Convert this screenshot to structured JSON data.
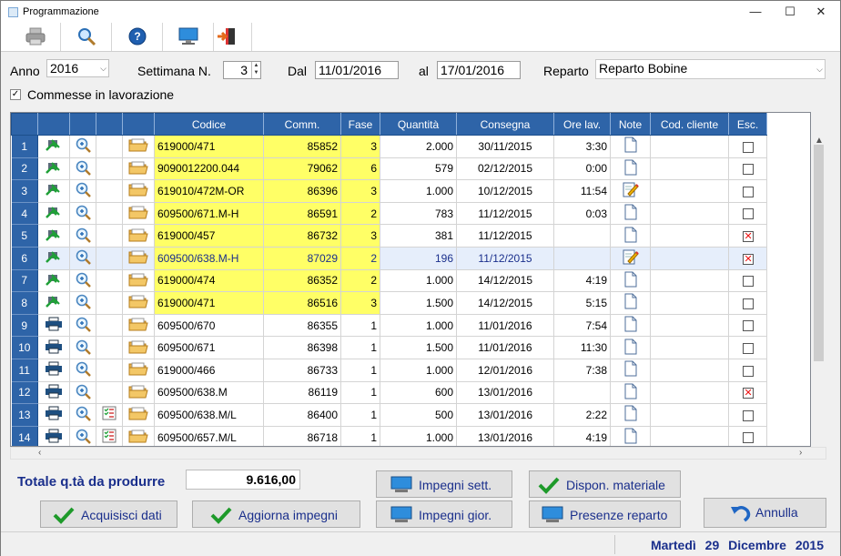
{
  "window": {
    "title": "Programmazione"
  },
  "filters": {
    "anno_label": "Anno",
    "anno_value": "2016",
    "settimana_label": "Settimana N.",
    "settimana_value": "3",
    "dal_label": "Dal",
    "dal_value": "11/01/2016",
    "al_label": "al",
    "al_value": "17/01/2016",
    "reparto_label": "Reparto",
    "reparto_value": "Reparto Bobine",
    "commesse_label": "Commesse in lavorazione",
    "commesse_checked": true
  },
  "grid": {
    "columns": [
      "",
      "",
      "",
      "",
      "",
      "Codice",
      "Comm.",
      "Fase",
      "Quantità",
      "Consegna",
      "Ore lav.",
      "Note",
      "Cod. cliente",
      "Esc."
    ],
    "rows": [
      {
        "n": "1",
        "codice": "619000/471",
        "comm": "85852",
        "fase": "3",
        "qta": "2.000",
        "consegna": "30/11/2015",
        "ore": "3:30",
        "note": "doc",
        "esc": false,
        "hl": true,
        "type": "print-green",
        "list": false
      },
      {
        "n": "2",
        "codice": "9090012200.044",
        "comm": "79062",
        "fase": "6",
        "qta": "579",
        "consegna": "02/12/2015",
        "ore": "0:00",
        "note": "doc",
        "esc": false,
        "hl": true,
        "type": "print-green",
        "list": false
      },
      {
        "n": "3",
        "codice": "619010/472M-OR",
        "comm": "86396",
        "fase": "3",
        "qta": "1.000",
        "consegna": "10/12/2015",
        "ore": "11:54",
        "note": "edit",
        "esc": false,
        "hl": true,
        "type": "print-green",
        "list": false
      },
      {
        "n": "4",
        "codice": "609500/671.M-H",
        "comm": "86591",
        "fase": "2",
        "qta": "783",
        "consegna": "11/12/2015",
        "ore": "0:03",
        "note": "doc",
        "esc": false,
        "hl": true,
        "type": "print-green",
        "list": false
      },
      {
        "n": "5",
        "codice": "619000/457",
        "comm": "86732",
        "fase": "3",
        "qta": "381",
        "consegna": "11/12/2015",
        "ore": "",
        "note": "doc",
        "esc": true,
        "hl": true,
        "type": "print-green",
        "list": false
      },
      {
        "n": "6",
        "codice": "609500/638.M-H",
        "comm": "87029",
        "fase": "2",
        "qta": "196",
        "consegna": "11/12/2015",
        "ore": "",
        "note": "edit",
        "esc": true,
        "hl": true,
        "sel": true,
        "type": "print-green",
        "list": false
      },
      {
        "n": "7",
        "codice": "619000/474",
        "comm": "86352",
        "fase": "2",
        "qta": "1.000",
        "consegna": "14/12/2015",
        "ore": "4:19",
        "note": "doc",
        "esc": false,
        "hl": true,
        "type": "print-green",
        "list": false
      },
      {
        "n": "8",
        "codice": "619000/471",
        "comm": "86516",
        "fase": "3",
        "qta": "1.500",
        "consegna": "14/12/2015",
        "ore": "5:15",
        "note": "doc",
        "esc": false,
        "hl": true,
        "type": "print-green",
        "list": false
      },
      {
        "n": "9",
        "codice": "609500/670",
        "comm": "86355",
        "fase": "1",
        "qta": "1.000",
        "consegna": "11/01/2016",
        "ore": "7:54",
        "note": "doc",
        "esc": false,
        "hl": false,
        "type": "print-blue",
        "list": false
      },
      {
        "n": "10",
        "codice": "609500/671",
        "comm": "86398",
        "fase": "1",
        "qta": "1.500",
        "consegna": "11/01/2016",
        "ore": "11:30",
        "note": "doc",
        "esc": false,
        "hl": false,
        "type": "print-blue",
        "list": false
      },
      {
        "n": "11",
        "codice": "619000/466",
        "comm": "86733",
        "fase": "1",
        "qta": "1.000",
        "consegna": "12/01/2016",
        "ore": "7:38",
        "note": "doc",
        "esc": false,
        "hl": false,
        "type": "print-blue",
        "list": false
      },
      {
        "n": "12",
        "codice": "609500/638.M",
        "comm": "86119",
        "fase": "1",
        "qta": "600",
        "consegna": "13/01/2016",
        "ore": "",
        "note": "doc",
        "esc": true,
        "hl": false,
        "type": "print-blue",
        "list": false
      },
      {
        "n": "13",
        "codice": "609500/638.M/L",
        "comm": "86400",
        "fase": "1",
        "qta": "500",
        "consegna": "13/01/2016",
        "ore": "2:22",
        "note": "doc",
        "esc": false,
        "hl": false,
        "type": "print-blue",
        "list": true
      },
      {
        "n": "14",
        "codice": "609500/657.M/L",
        "comm": "86718",
        "fase": "1",
        "qta": "1.000",
        "consegna": "13/01/2016",
        "ore": "4:19",
        "note": "doc",
        "esc": false,
        "hl": false,
        "type": "print-blue",
        "list": true
      }
    ]
  },
  "totals": {
    "label": "Totale q.tà da produrre",
    "value": "9.616,00"
  },
  "buttons": {
    "acquisisci": "Acquisisci dati",
    "aggiorna": "Aggiorna impegni",
    "impegni_sett": "Impegni sett.",
    "impegni_gior": "Impegni gior.",
    "dispon": "Dispon. materiale",
    "presenze": "Presenze reparto",
    "annulla": "Annulla"
  },
  "status": {
    "weekday": "Martedì",
    "date": "29 Dicembre",
    "year": "2015"
  },
  "colors": {
    "accent": "#2e64a8",
    "highlight": "#ffff66",
    "text_blue": "#1a2f8c"
  }
}
